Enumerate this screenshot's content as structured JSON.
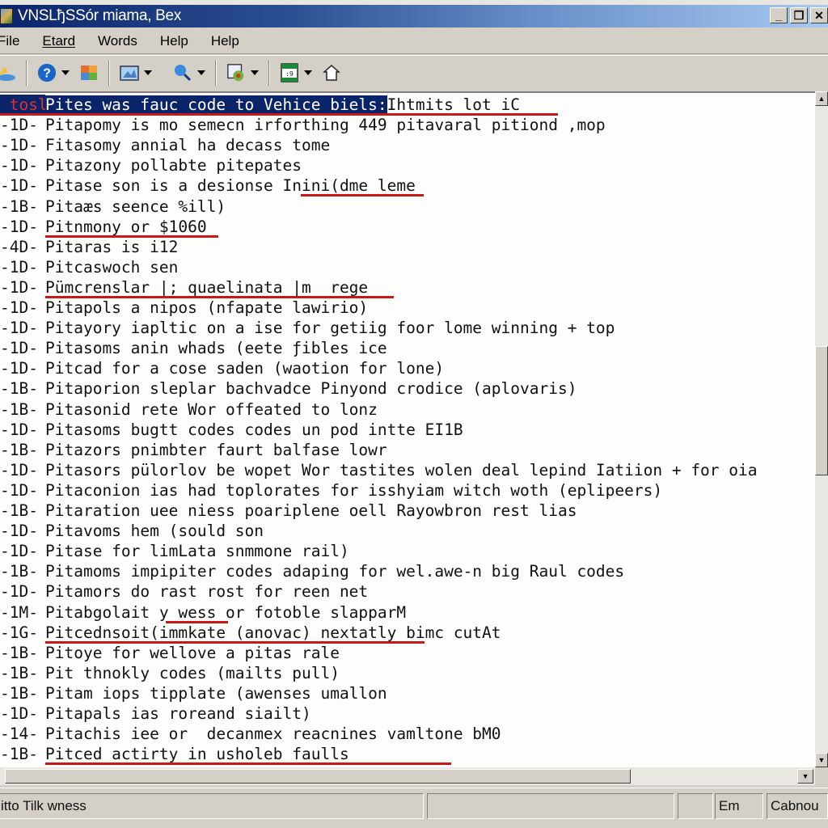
{
  "window": {
    "title": "VNSLђSSór miama, Bex",
    "buttons": {
      "minimize": "_",
      "restore": "❐",
      "close": "✕"
    }
  },
  "menu": {
    "items": [
      {
        "label": "File",
        "accel": "F"
      },
      {
        "label": "Etard",
        "accel": "E"
      },
      {
        "label": "Words",
        "accel": "W"
      },
      {
        "label": "Help",
        "accel": "H"
      },
      {
        "label": "Help",
        "accel": "H"
      }
    ]
  },
  "toolbar": {
    "buttons": [
      {
        "icon": "folder-icon",
        "glyph": "📂",
        "dropdown": false
      },
      {
        "icon": "help-icon",
        "glyph": "?",
        "dropdown": true
      },
      {
        "icon": "office-icon",
        "glyph": "▦",
        "dropdown": false
      },
      {
        "icon": "picture-icon",
        "glyph": "🖼",
        "dropdown": true
      },
      {
        "icon": "search-icon",
        "glyph": "🔍",
        "dropdown": true
      },
      {
        "icon": "document-settings-icon",
        "glyph": "🗎",
        "dropdown": true
      },
      {
        "icon": "calendar-icon",
        "glyph": "▤",
        "dropdown": true
      },
      {
        "icon": "home-icon",
        "glyph": "⌂",
        "dropdown": false
      }
    ]
  },
  "editor": {
    "lines": [
      {
        "code": " tosl",
        "text": " Pites was fauc code to Vehice biels:",
        "rest": "Ihtmits lot iC",
        "selected": true
      },
      {
        "code": "-1D-",
        "text": " Pitapomy is mo semecn irforthing 449 pitavaral pitiond ,mop"
      },
      {
        "code": "-1D-",
        "text": " Fitasomy annial ha decass tome"
      },
      {
        "code": "-1D-",
        "text": " Pitazony pollabte pitepates"
      },
      {
        "code": "-1D-",
        "text": " Pitase son is a desionse Inini(dme leme"
      },
      {
        "code": "-1B-",
        "text": " Pitaæs seence %ill)"
      },
      {
        "code": "-1D-",
        "text": " Pitnmony or $1060"
      },
      {
        "code": "-4D-",
        "text": " Pitaras is i12"
      },
      {
        "code": "-1D-",
        "text": " Pitcaswoch sen"
      },
      {
        "code": "-1D-",
        "text": " Pümcrenslar |; quaelinata |m  rege"
      },
      {
        "code": "-1D-",
        "text": " Pitapols a nipos (nfapate lawirio)"
      },
      {
        "code": "-1D-",
        "text": " Pitayory iapltic on a ise for getiig foor lome winning + top"
      },
      {
        "code": "-1D-",
        "text": " Pitasoms anin whads (eete ƒibles ice"
      },
      {
        "code": "-1D-",
        "text": " Pitcad for a cose saden (waotion for lone)"
      },
      {
        "code": "-1B-",
        "text": " Pitaporion sleplar bachvadce Pinyond crodice (aplovaris)"
      },
      {
        "code": "-1B-",
        "text": " Pitasonid rete Wor offeated to lonz"
      },
      {
        "code": "-1D-",
        "text": " Pitasoms bugtt codes codes un pod intte EI1B"
      },
      {
        "code": "-1B-",
        "text": " Pitazors pnimbter faurt balfase lowr"
      },
      {
        "code": "-1D-",
        "text": " Pitasors pülorlov be wopet Wor tastites wolen deal lepind Iatiion + for oia"
      },
      {
        "code": "-1D-",
        "text": " Pitaconion ias had toplorates for isshyiam witch woth (eplipeers)"
      },
      {
        "code": "-1B-",
        "text": " Pitaration uee niess poariplene oell Rayowbron rest lias"
      },
      {
        "code": "-1D-",
        "text": " Pitavoms hem (sould son"
      },
      {
        "code": "-1D-",
        "text": " Pitase for limLata snmmone rail)"
      },
      {
        "code": "-1B-",
        "text": " Pitamoms impipiter codes adaping for wel.awe-n big Raul codes"
      },
      {
        "code": "-1D-",
        "text": " Pitamors do rast rost for reen net"
      },
      {
        "code": "-1M-",
        "text": " Pitabgolait y wess or fotoble slapparM"
      },
      {
        "code": "-1G-",
        "text": " Pitcednsoit(immkate (anovac) nextatly bimc cutAt"
      },
      {
        "code": "-1B-",
        "text": " Pitoye for wellove a pitas rale"
      },
      {
        "code": "-1B-",
        "text": " Pit thnokly codes (mailts pull)"
      },
      {
        "code": "-1B-",
        "text": " Pitam iops tipplate (awenses umallon"
      },
      {
        "code": "-1D-",
        "text": " Pitapals ias roreand siailt)"
      },
      {
        "code": "-14-",
        "text": " Pitachis iee or  decanmex reacnines vamltone bM0"
      },
      {
        "code": "-1B-",
        "text": " Pitced actirty in usholeb faulls"
      }
    ]
  },
  "statusbar": {
    "message": "itto Tilk wness",
    "indicator": "Em",
    "right": "Cabnou"
  },
  "colors": {
    "selection": "#0a246a",
    "underline": "#c81818",
    "chrome": "#d4d0c8"
  }
}
